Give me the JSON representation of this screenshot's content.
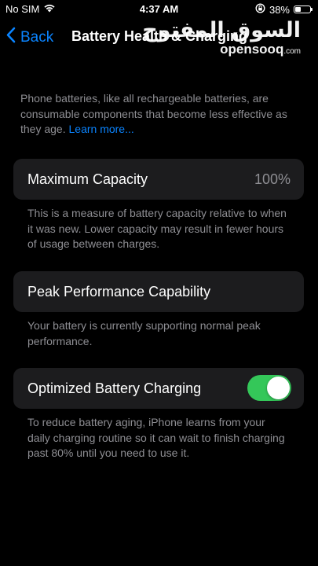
{
  "status_bar": {
    "carrier": "No SIM",
    "time": "4:37 AM",
    "battery_percent": "38%",
    "battery_level": 0.38,
    "icons": [
      "wifi-icon",
      "rotation-lock-icon",
      "battery-icon"
    ]
  },
  "nav": {
    "back_label": "Back",
    "title": "Battery Health & Charging"
  },
  "watermark": {
    "arabic": "السوق المفتوح",
    "latin": "opensooq",
    "suffix": ".com"
  },
  "intro": {
    "text": "Phone batteries, like all rechargeable batteries, are consumable components that become less effective as they age. ",
    "link": "Learn more..."
  },
  "maximum_capacity": {
    "label": "Maximum Capacity",
    "value": "100%",
    "footer": "This is a measure of battery capacity relative to when it was new. Lower capacity may result in fewer hours of usage between charges."
  },
  "peak_performance": {
    "label": "Peak Performance Capability",
    "footer": "Your battery is currently supporting normal peak performance."
  },
  "optimized_charging": {
    "label": "Optimized Battery Charging",
    "enabled": true,
    "footer": "To reduce battery aging, iPhone learns from your daily charging routine so it can wait to finish charging past 80% until you need to use it."
  },
  "colors": {
    "accent": "#0a84ff",
    "toggle_on": "#34c759",
    "card_bg": "#1c1c1e",
    "secondary_text": "#8e8e93",
    "background": "#000000"
  }
}
